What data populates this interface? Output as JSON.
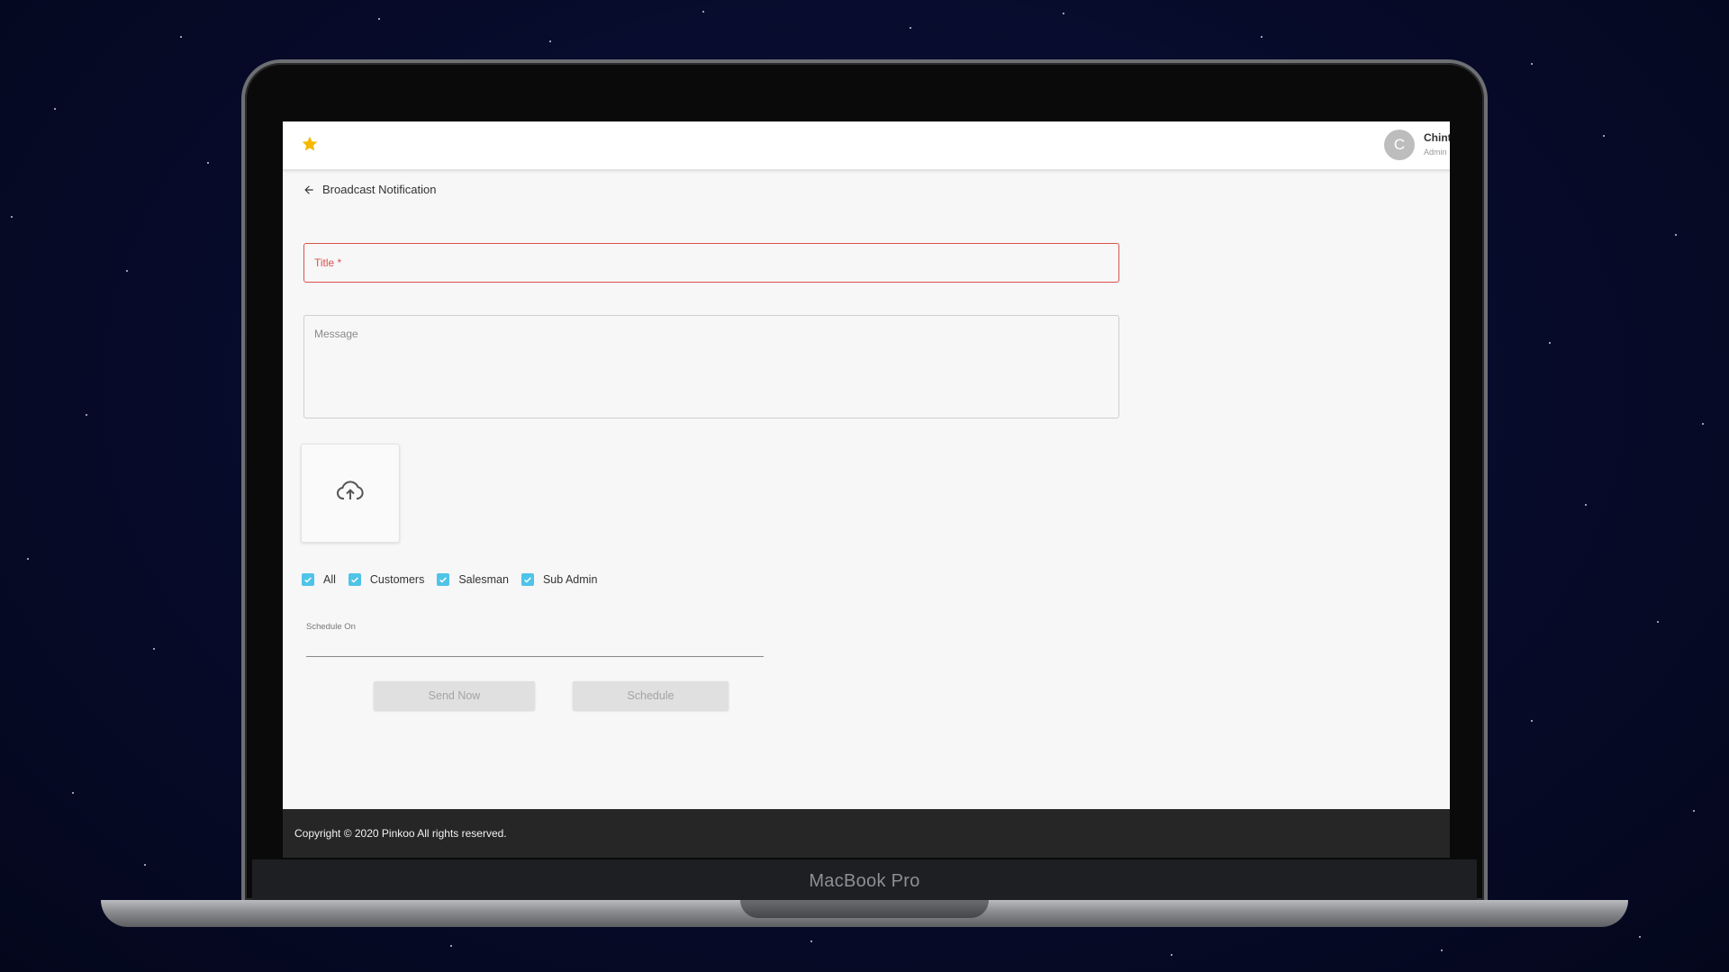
{
  "app": {
    "user_initial": "C",
    "user_name": "Chint",
    "user_role": "Admin"
  },
  "header": {
    "title": "Broadcast Notification"
  },
  "form": {
    "title_placeholder": "Title *",
    "message_placeholder": "Message",
    "recipients": [
      {
        "label": "All",
        "checked": true
      },
      {
        "label": "Customers",
        "checked": true
      },
      {
        "label": "Salesman",
        "checked": true
      },
      {
        "label": "Sub Admin",
        "checked": true
      }
    ],
    "schedule_label": "Schedule On",
    "send_now_label": "Send Now",
    "schedule_label_button": "Schedule"
  },
  "footer": {
    "copyright": "Copyright © 2020 Pinkoo All rights reserved."
  },
  "device": {
    "label": "MacBook Pro"
  },
  "colors": {
    "accent": "#4fc3e8",
    "error": "#d9534f",
    "star": "#f5b800",
    "footer_bg": "#262626"
  },
  "icons": {
    "logo": "star-icon",
    "back": "arrow-left-icon",
    "upload": "cloud-upload-icon",
    "check": "checkmark-icon"
  }
}
